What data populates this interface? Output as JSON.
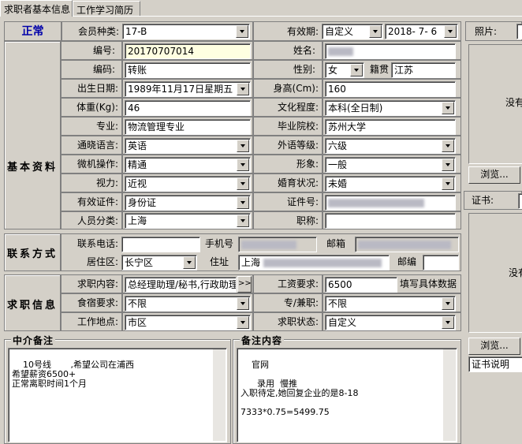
{
  "tabs": [
    "求职者基本信息",
    "工作学习简历"
  ],
  "status": "正常",
  "member_type": {
    "label": "会员种类:",
    "value": "17-B"
  },
  "validity": {
    "label": "有效期:",
    "mode": "自定义",
    "date": "2018- 7- 6"
  },
  "section_basic": "基本资料",
  "section_contact": "联系方式",
  "section_job": "求职信息",
  "basic": {
    "id_label": "编号:",
    "id_value": "20170707014",
    "name_label": "姓名:",
    "code_label": "编码:",
    "code_value": "转账",
    "gender_label": "性别:",
    "gender_value": "女",
    "native_label": "籍贯",
    "native_value": "江苏",
    "birth_label": "出生日期:",
    "birth_value": "1989年11月17日星期五",
    "height_label": "身高(Cm):",
    "height_value": "160",
    "weight_label": "体重(Kg):",
    "weight_value": "46",
    "edu_label": "文化程度:",
    "edu_value": "本科(全日制)",
    "major_label": "专业:",
    "major_value": "物流管理专业",
    "school_label": "毕业院校:",
    "school_value": "苏州大学",
    "lang_label": "通晓语言:",
    "lang_value": "英语",
    "foreign_label": "外语等级:",
    "foreign_value": "六级",
    "computer_label": "微机操作:",
    "computer_value": "精通",
    "image_label": "形象:",
    "image_value": "一般",
    "vision_label": "视力:",
    "vision_value": "近视",
    "marital_label": "婚育状况:",
    "marital_value": "未婚",
    "idtype_label": "有效证件:",
    "idtype_value": "身份证",
    "idno_label": "证件号:",
    "category_label": "人员分类:",
    "category_value": "上海",
    "title_label": "职称:"
  },
  "contact": {
    "phone_label": "联系电话:",
    "mobile_label": "手机号",
    "email_label": "邮箱",
    "district_label": "居住区:",
    "district_value": "长宁区",
    "address_label": "住址",
    "address_value": "上海",
    "postcode_label": "邮编"
  },
  "job": {
    "content_label": "求职内容:",
    "content_value": "总经理助理/秘书,行政助理",
    "salary_label": "工资要求:",
    "salary_value": "6500",
    "salary_hint": "填写具体数据",
    "board_label": "食宿要求:",
    "board_value": "不限",
    "parttime_label": "专/兼职:",
    "parttime_value": "不限",
    "location_label": "工作地点:",
    "location_value": "市区",
    "state_label": "求职状态:",
    "state_value": "自定义",
    "more_button": ">>"
  },
  "agent_note": {
    "title": "中介备注",
    "text": "10号线       ,希望公司在浦西\n希望薪资6500+\n正常离职时间1个月"
  },
  "remark": {
    "title": "备注内容",
    "text": "官网\n\n      录用  慢推\n入职待定,她回复企业的是8-18\n\n7333*0.75=5499.75"
  },
  "photo": {
    "label": "照片:",
    "placeholder": "没有",
    "browse": "浏览..."
  },
  "cert": {
    "label": "证书:",
    "placeholder": "没有",
    "browse": "浏览...",
    "desc": "证书说明"
  }
}
